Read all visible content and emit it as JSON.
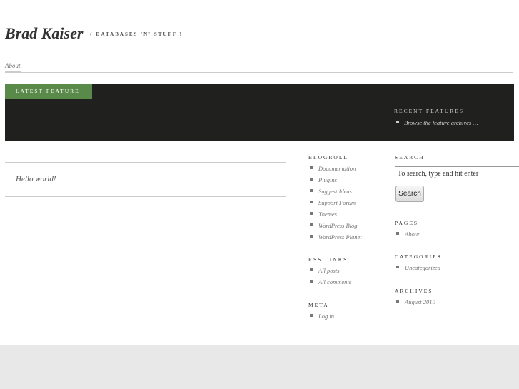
{
  "header": {
    "site_title": "Brad Kaiser",
    "site_description": "{ databases 'n' stuff }"
  },
  "nav": {
    "items": [
      {
        "label": "About"
      }
    ]
  },
  "feature": {
    "tab_label": "Latest Feature",
    "recent_title": "Recent Features",
    "recent_items": [
      {
        "label": "Browse the feature archives …"
      }
    ]
  },
  "posts": [
    {
      "title": "Hello world!"
    }
  ],
  "sidebar_left": {
    "blogroll": {
      "title": "Blogroll",
      "items": [
        {
          "label": "Documentation"
        },
        {
          "label": "Plugins"
        },
        {
          "label": "Suggest Ideas"
        },
        {
          "label": "Support Forum"
        },
        {
          "label": "Themes"
        },
        {
          "label": "WordPress Blog"
        },
        {
          "label": "WordPress Planet"
        }
      ]
    },
    "rss": {
      "title": "RSS Links",
      "items": [
        {
          "label": "All posts"
        },
        {
          "label": "All comments"
        }
      ]
    },
    "meta": {
      "title": "Meta",
      "items": [
        {
          "label": "Log in"
        }
      ]
    }
  },
  "sidebar_right": {
    "search": {
      "title": "Search",
      "input_value": "To search, type and hit enter",
      "button_label": "Search"
    },
    "pages": {
      "title": "Pages",
      "items": [
        {
          "label": "About"
        }
      ]
    },
    "categories": {
      "title": "Categories",
      "items": [
        {
          "label": "Uncategorized"
        }
      ]
    },
    "archives": {
      "title": "Archives",
      "items": [
        {
          "label": "August 2010"
        }
      ]
    }
  },
  "colors": {
    "feature_band": "#20201e",
    "feature_tab": "#5a8a4a",
    "footer": "#e8e8e8"
  }
}
